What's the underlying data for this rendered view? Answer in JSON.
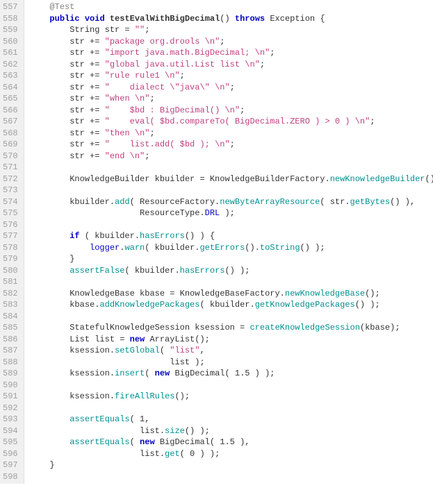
{
  "gutter": {
    "start": 557,
    "end": 598
  },
  "lines": [
    {
      "indent": 4,
      "parts": [
        {
          "cls": "annotation",
          "t": "@Test"
        }
      ]
    },
    {
      "indent": 4,
      "parts": [
        {
          "cls": "keyword",
          "t": "public"
        },
        {
          "t": " "
        },
        {
          "cls": "keyword",
          "t": "void"
        },
        {
          "t": " "
        },
        {
          "cls": "method-decl",
          "t": "testEvalWithBigDecimal"
        },
        {
          "t": "() "
        },
        {
          "cls": "keyword",
          "t": "throws"
        },
        {
          "t": " Exception {"
        }
      ]
    },
    {
      "indent": 8,
      "parts": [
        {
          "t": "String str = "
        },
        {
          "cls": "string-pink",
          "t": "\"\""
        },
        {
          "t": ";"
        }
      ]
    },
    {
      "indent": 8,
      "parts": [
        {
          "t": "str += "
        },
        {
          "cls": "string-pink",
          "t": "\"package org.drools \\n\""
        },
        {
          "t": ";"
        }
      ]
    },
    {
      "indent": 8,
      "parts": [
        {
          "t": "str += "
        },
        {
          "cls": "string-pink",
          "t": "\"import java.math.BigDecimal; \\n\""
        },
        {
          "t": ";"
        }
      ]
    },
    {
      "indent": 8,
      "parts": [
        {
          "t": "str += "
        },
        {
          "cls": "string-pink",
          "t": "\"global java.util.List list \\n\""
        },
        {
          "t": ";"
        }
      ]
    },
    {
      "indent": 8,
      "parts": [
        {
          "t": "str += "
        },
        {
          "cls": "string-pink",
          "t": "\"rule rule1 \\n\""
        },
        {
          "t": ";"
        }
      ]
    },
    {
      "indent": 8,
      "parts": [
        {
          "t": "str += "
        },
        {
          "cls": "string-pink",
          "t": "\"    dialect \\\"java\\\" \\n\""
        },
        {
          "t": ";"
        }
      ]
    },
    {
      "indent": 8,
      "parts": [
        {
          "t": "str += "
        },
        {
          "cls": "string-pink",
          "t": "\"when \\n\""
        },
        {
          "t": ";"
        }
      ]
    },
    {
      "indent": 8,
      "parts": [
        {
          "t": "str += "
        },
        {
          "cls": "string-pink",
          "t": "\"    $bd : BigDecimal() \\n\""
        },
        {
          "t": ";"
        }
      ]
    },
    {
      "indent": 8,
      "parts": [
        {
          "t": "str += "
        },
        {
          "cls": "string-pink",
          "t": "\"    eval( $bd.compareTo( BigDecimal.ZERO ) > 0 ) \\n\""
        },
        {
          "t": ";"
        }
      ]
    },
    {
      "indent": 8,
      "parts": [
        {
          "t": "str += "
        },
        {
          "cls": "string-pink",
          "t": "\"then \\n\""
        },
        {
          "t": ";"
        }
      ]
    },
    {
      "indent": 8,
      "parts": [
        {
          "t": "str += "
        },
        {
          "cls": "string-pink",
          "t": "\"    list.add( $bd ); \\n\""
        },
        {
          "t": ";"
        }
      ]
    },
    {
      "indent": 8,
      "parts": [
        {
          "t": "str += "
        },
        {
          "cls": "string-pink",
          "t": "\"end \\n\""
        },
        {
          "t": ";"
        }
      ]
    },
    {
      "indent": 0,
      "parts": []
    },
    {
      "indent": 8,
      "parts": [
        {
          "t": "KnowledgeBuilder kbuilder = KnowledgeBuilderFactory."
        },
        {
          "cls": "method-call",
          "t": "newKnowledgeBuilder"
        },
        {
          "t": "();"
        }
      ]
    },
    {
      "indent": 0,
      "parts": []
    },
    {
      "indent": 8,
      "parts": [
        {
          "t": "kbuilder."
        },
        {
          "cls": "method-call",
          "t": "add"
        },
        {
          "t": "( ResourceFactory."
        },
        {
          "cls": "method-call",
          "t": "newByteArrayResource"
        },
        {
          "t": "( str."
        },
        {
          "cls": "method-call",
          "t": "getBytes"
        },
        {
          "t": "() ),"
        }
      ]
    },
    {
      "indent": 22,
      "parts": [
        {
          "t": "ResourceType."
        },
        {
          "cls": "field",
          "t": "DRL"
        },
        {
          "t": " );"
        }
      ]
    },
    {
      "indent": 0,
      "parts": []
    },
    {
      "indent": 8,
      "parts": [
        {
          "cls": "keyword",
          "t": "if"
        },
        {
          "t": " ( kbuilder."
        },
        {
          "cls": "method-call",
          "t": "hasErrors"
        },
        {
          "t": "() ) {"
        }
      ]
    },
    {
      "indent": 12,
      "parts": [
        {
          "cls": "field",
          "t": "logger"
        },
        {
          "t": "."
        },
        {
          "cls": "method-call",
          "t": "warn"
        },
        {
          "t": "( kbuilder."
        },
        {
          "cls": "method-call",
          "t": "getErrors"
        },
        {
          "t": "()."
        },
        {
          "cls": "method-call",
          "t": "toString"
        },
        {
          "t": "() );"
        }
      ]
    },
    {
      "indent": 8,
      "parts": [
        {
          "t": "}"
        }
      ]
    },
    {
      "indent": 8,
      "parts": [
        {
          "cls": "method-call",
          "t": "assertFalse"
        },
        {
          "t": "( kbuilder."
        },
        {
          "cls": "method-call",
          "t": "hasErrors"
        },
        {
          "t": "() );"
        }
      ]
    },
    {
      "indent": 0,
      "parts": []
    },
    {
      "indent": 8,
      "parts": [
        {
          "t": "KnowledgeBase kbase = KnowledgeBaseFactory."
        },
        {
          "cls": "method-call",
          "t": "newKnowledgeBase"
        },
        {
          "t": "();"
        }
      ]
    },
    {
      "indent": 8,
      "parts": [
        {
          "t": "kbase."
        },
        {
          "cls": "method-call",
          "t": "addKnowledgePackages"
        },
        {
          "t": "( kbuilder."
        },
        {
          "cls": "method-call",
          "t": "getKnowledgePackages"
        },
        {
          "t": "() );"
        }
      ]
    },
    {
      "indent": 0,
      "parts": []
    },
    {
      "indent": 8,
      "parts": [
        {
          "t": "StatefulKnowledgeSession ksession = "
        },
        {
          "cls": "method-call",
          "t": "createKnowledgeSession"
        },
        {
          "t": "(kbase);"
        }
      ]
    },
    {
      "indent": 8,
      "parts": [
        {
          "t": "List list = "
        },
        {
          "cls": "keyword",
          "t": "new"
        },
        {
          "t": " ArrayList();"
        }
      ]
    },
    {
      "indent": 8,
      "parts": [
        {
          "t": "ksession."
        },
        {
          "cls": "method-call",
          "t": "setGlobal"
        },
        {
          "t": "( "
        },
        {
          "cls": "string-pink",
          "t": "\"list\""
        },
        {
          "t": ","
        }
      ]
    },
    {
      "indent": 28,
      "parts": [
        {
          "t": "list );"
        }
      ]
    },
    {
      "indent": 8,
      "parts": [
        {
          "t": "ksession."
        },
        {
          "cls": "method-call",
          "t": "insert"
        },
        {
          "t": "( "
        },
        {
          "cls": "keyword",
          "t": "new"
        },
        {
          "t": " BigDecimal( 1.5 ) );"
        }
      ]
    },
    {
      "indent": 0,
      "parts": []
    },
    {
      "indent": 8,
      "parts": [
        {
          "t": "ksession."
        },
        {
          "cls": "method-call",
          "t": "fireAllRules"
        },
        {
          "t": "();"
        }
      ]
    },
    {
      "indent": 0,
      "parts": []
    },
    {
      "indent": 8,
      "parts": [
        {
          "cls": "method-call",
          "t": "assertEquals"
        },
        {
          "t": "( 1,"
        }
      ]
    },
    {
      "indent": 22,
      "parts": [
        {
          "t": "list."
        },
        {
          "cls": "method-call",
          "t": "size"
        },
        {
          "t": "() );"
        }
      ]
    },
    {
      "indent": 8,
      "parts": [
        {
          "cls": "method-call",
          "t": "assertEquals"
        },
        {
          "t": "( "
        },
        {
          "cls": "keyword",
          "t": "new"
        },
        {
          "t": " BigDecimal( 1.5 ),"
        }
      ]
    },
    {
      "indent": 22,
      "parts": [
        {
          "t": "list."
        },
        {
          "cls": "method-call",
          "t": "get"
        },
        {
          "t": "( 0 ) );"
        }
      ]
    },
    {
      "indent": 4,
      "parts": [
        {
          "t": "}"
        }
      ]
    },
    {
      "indent": 0,
      "parts": []
    }
  ]
}
